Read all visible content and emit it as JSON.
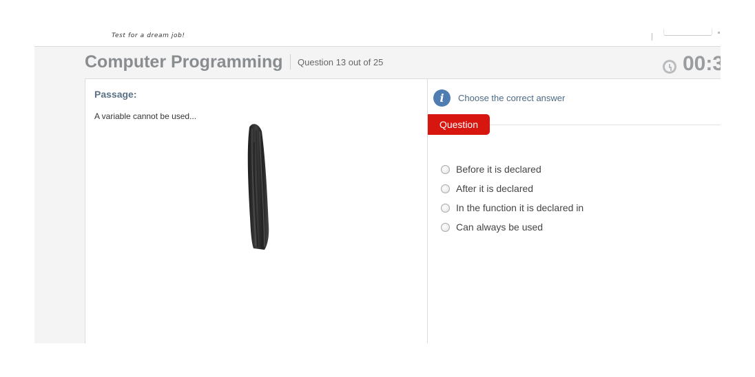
{
  "header": {
    "tagline": "Test for a dream job!"
  },
  "exam": {
    "title": "Computer Programming",
    "question_counter": "Question 13 out of 25",
    "timer": "00:3"
  },
  "passage": {
    "heading": "Passage:",
    "text": "A variable cannot be used..."
  },
  "question": {
    "instruction": "Choose the correct answer",
    "tab_label": "Question",
    "options": [
      {
        "label": "Before it is declared",
        "selected": false
      },
      {
        "label": "After it is declared",
        "selected": false
      },
      {
        "label": "In the function it is declared in",
        "selected": false
      },
      {
        "label": "Can always be used",
        "selected": false
      }
    ]
  },
  "colors": {
    "accent_red": "#d7160f",
    "info_blue": "#4f7db1",
    "heading_slate": "#5b7186",
    "title_gray": "#8a8d90"
  },
  "icons": {
    "timer": "clock-icon",
    "instruction": "info-icon",
    "option": "radio-button"
  }
}
